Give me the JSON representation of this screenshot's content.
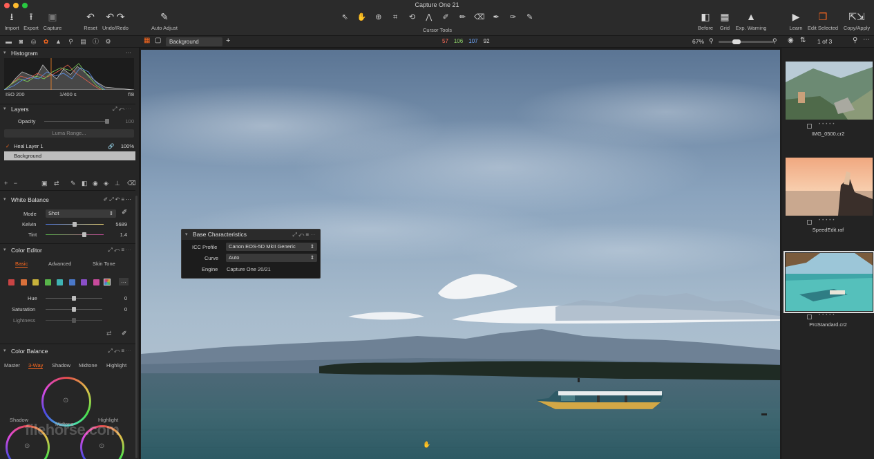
{
  "window": {
    "title": "Capture One 21"
  },
  "toolbar": {
    "left_buttons": [
      {
        "label": "Import",
        "icon": "import-icon"
      },
      {
        "label": "Export",
        "icon": "export-icon"
      },
      {
        "label": "Capture",
        "icon": "camera-icon"
      },
      {
        "label": "Reset",
        "icon": "reset-icon"
      },
      {
        "label": "Undo/Redo",
        "icon": "undo-redo-icon"
      },
      {
        "label": "Auto Adjust",
        "icon": "magic-wand-icon"
      }
    ],
    "cursor_tools_label": "Cursor Tools",
    "right_buttons": [
      {
        "label": "Before",
        "icon": "before-after-icon"
      },
      {
        "label": "Grid",
        "icon": "grid-icon"
      },
      {
        "label": "Exp. Warning",
        "icon": "warning-icon"
      },
      {
        "label": "Learn",
        "icon": "play-icon"
      },
      {
        "label": "Edit Selected",
        "icon": "edit-selected-icon"
      },
      {
        "label": "Copy/Apply",
        "icon": "copy-apply-icon"
      }
    ]
  },
  "subbar": {
    "variant_selector": "Background",
    "rgb": {
      "r": "57",
      "g": "106",
      "b": "107",
      "l": "92"
    },
    "zoom": "67%",
    "page_count": "1 of 3"
  },
  "histogram": {
    "title": "Histogram",
    "iso": "ISO 200",
    "shutter": "1/400 s",
    "aperture": "f/8"
  },
  "layers": {
    "title": "Layers",
    "opacity_label": "Opacity",
    "opacity_value": "100",
    "luma_range": "Luma Range...",
    "items": [
      {
        "name": "Heal Layer 1",
        "value": "100%"
      },
      {
        "name": "Background",
        "value": ""
      }
    ]
  },
  "white_balance": {
    "title": "White Balance",
    "mode_label": "Mode",
    "mode_value": "Shot",
    "kelvin_label": "Kelvin",
    "kelvin_value": "5689",
    "kelvin_fraction": 0.5,
    "tint_label": "Tint",
    "tint_value": "1.4",
    "tint_fraction": 0.68
  },
  "color_editor": {
    "title": "Color Editor",
    "tabs": [
      "Basic",
      "Advanced",
      "Skin Tone"
    ],
    "hue_label": "Hue",
    "hue_value": "0",
    "saturation_label": "Saturation",
    "saturation_value": "0",
    "lightness_label": "Lightness",
    "swatch_colors": [
      "#c94444",
      "#d9703a",
      "#c8b23b",
      "#58b54a",
      "#3fb3b3",
      "#4a78c9",
      "#8a4fc8",
      "#c84a9c"
    ]
  },
  "color_balance": {
    "title": "Color Balance",
    "tabs": [
      "Master",
      "3-Way",
      "Shadow",
      "Midtone",
      "Highlight"
    ],
    "wheel_labels": [
      "Shadow",
      "Midtone",
      "Highlight"
    ]
  },
  "base_characteristics": {
    "title": "Base Characteristics",
    "icc_label": "ICC Profile",
    "icc_value": "Canon EOS-5D MkII Generic",
    "curve_label": "Curve",
    "curve_value": "Auto",
    "engine_label": "Engine",
    "engine_value": "Capture One 20/21"
  },
  "browser": {
    "items": [
      {
        "name": "IMG_0500.cr2"
      },
      {
        "name": "SpeedEdit.raf"
      },
      {
        "name": "ProStandard.cr2"
      }
    ]
  },
  "watermark": "filehorse.com"
}
